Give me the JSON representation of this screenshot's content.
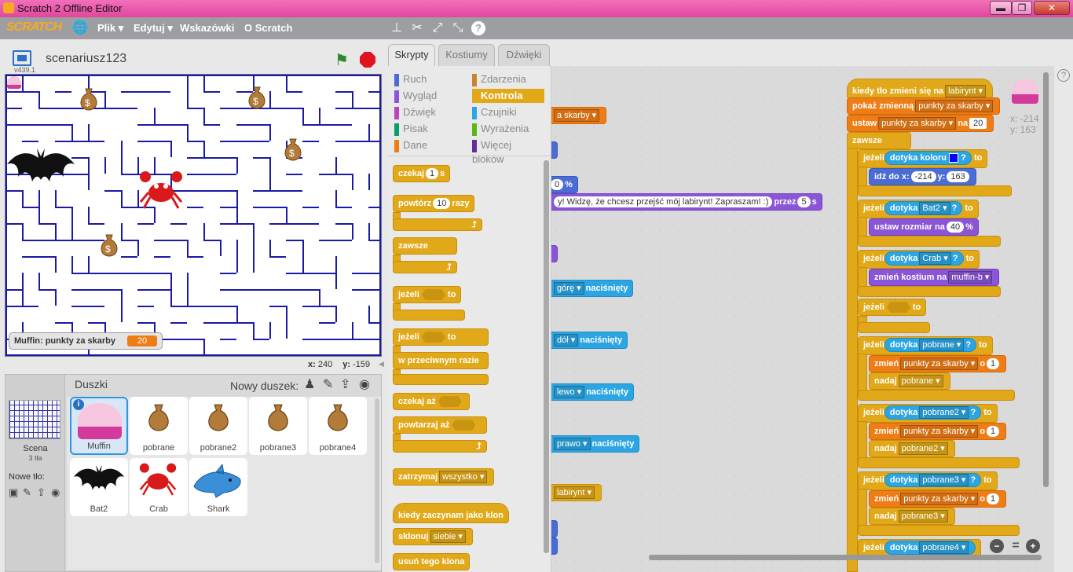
{
  "window": {
    "title": "Scratch 2 Offline Editor",
    "minimize": "▬",
    "maximize": "❐",
    "close": "✕"
  },
  "menu": {
    "logo": "SCRATCH",
    "file": "Plik",
    "edit": "Edytuj",
    "tips": "Wskazówki",
    "about": "O Scratch"
  },
  "stage": {
    "project_name": "scenariusz123",
    "version": "v439.1",
    "x_label": "x:",
    "x_value": "240",
    "y_label": "y:",
    "y_value": "-159",
    "monitor_label": "Muffin: punkty za skarby",
    "monitor_value": "20"
  },
  "tabs": [
    "Skrypty",
    "Kostiumy",
    "Dźwięki"
  ],
  "categories": {
    "left": [
      {
        "label": "Ruch",
        "color": "#4a6cd4"
      },
      {
        "label": "Wygląd",
        "color": "#8a55d7"
      },
      {
        "label": "Dźwięk",
        "color": "#bb42c3"
      },
      {
        "label": "Pisak",
        "color": "#0e9a6c"
      },
      {
        "label": "Dane",
        "color": "#ee7d16"
      }
    ],
    "right": [
      {
        "label": "Zdarzenia",
        "color": "#c88330"
      },
      {
        "label": "Kontrola",
        "color": "#e1a91a"
      },
      {
        "label": "Czujniki",
        "color": "#2ca5e2"
      },
      {
        "label": "Wyrażenia",
        "color": "#5cb712"
      },
      {
        "label": "Więcej bloków",
        "color": "#632d99"
      }
    ]
  },
  "palette": {
    "wait": "czekaj",
    "wait_val": "1",
    "wait_unit": "s",
    "repeat": "powtórz",
    "repeat_val": "10",
    "repeat_unit": "razy",
    "forever": "zawsze",
    "if": "jeżeli",
    "then": "to",
    "else": "w przeciwnym razie",
    "wait_until": "czekaj aż",
    "repeat_until": "powtarzaj aż",
    "stop": "zatrzymaj",
    "stop_val": "wszystko",
    "clone_start": "kiedy zaczynam jako klon",
    "clone": "sklonuj",
    "clone_val": "siebie",
    "delete_clone": "usuń tego klona"
  },
  "script_left": {
    "b1": "a skarby",
    "b2_text": "y! Widzę, że chcesz przejść mój labirynt! Zapraszam! :)",
    "b2_for": "przez",
    "b2_val": "5",
    "b2_unit": "s",
    "key_up": "górę",
    "key_down": "dół",
    "key_left": "lewo",
    "key_right": "prawo",
    "pressed": "naciśnięty",
    "backdrop": "labirynt",
    "key_up_val": "",
    "pct": "%"
  },
  "script_main": {
    "hat": "kiedy tło zmieni się na",
    "hat_val": "labirynt",
    "show": "pokaż zmienną",
    "var": "punkty za skarby",
    "set": "ustaw",
    "set_to": "na",
    "set_val": "20",
    "forever": "zawsze",
    "if": "jeżeli",
    "then": "to",
    "touch_color": "dotyka koloru",
    "q": "?",
    "goto": "idź do x:",
    "goto_x": "-214",
    "goto_y_label": "y:",
    "goto_y": "163",
    "touching": "dotyka",
    "bat": "Bat2",
    "size": "ustaw rozmiar na",
    "size_val": "40",
    "pct": "%",
    "crab": "Crab",
    "costume": "zmień kostium na",
    "costume_val": "muffin-b",
    "p1": "pobrane",
    "p2": "pobrane2",
    "p3": "pobrane3",
    "p4": "pobrane4",
    "change": "zmień",
    "by": "o",
    "by_val": "1",
    "give": "nadaj"
  },
  "coords": {
    "x": "x: -214",
    "y": "y: 163"
  },
  "sprites": {
    "header": "Duszki",
    "new_sprite": "Nowy duszek:",
    "scene_label": "Scena",
    "scene_sub": "3 tła",
    "new_bg": "Nowe tło:",
    "items": [
      "Muffin",
      "pobrane",
      "pobrane2",
      "pobrane3",
      "pobrane4",
      "Bat2",
      "Crab",
      "Shark"
    ],
    "info": "i"
  },
  "zoom": {
    "out": "−",
    "reset": "=",
    "in": "+"
  },
  "help": "?"
}
